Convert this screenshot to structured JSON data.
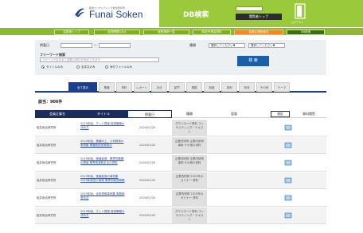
{
  "header": {
    "logo_small": "経営コンサルティング総合研究所",
    "logo_text": "Funai Soken",
    "db_title": "DB検索",
    "top_button": "閲覧者トップ",
    "user_icon_label": "ログアウト"
  },
  "nav": {
    "items": [
      {
        "label": "会員様トップ"
      },
      {
        "label": "経営問題Q＆A"
      },
      {
        "label": "経営事例一覧"
      },
      {
        "label": "時流予測会資料"
      },
      {
        "label": "会員企業様案内"
      },
      {
        "label": "DB検索"
      }
    ]
  },
  "search": {
    "period_label": "掲載日",
    "period_sep": "〜",
    "category_label": "種類",
    "category_value1": "選択してください▼",
    "category_value2": "選択してください▼",
    "freeword_label": "フリーワード検索",
    "freeword_placeholder": "スペースで区切ると複数の条件を指定できます",
    "radio_title": "タイトルのみ",
    "radio_all": "全本文のみ",
    "radio_file": "添付ファイルのみ",
    "search_button": "検 索"
  },
  "tabs": [
    {
      "label": "全て表示"
    },
    {
      "label": "業種"
    },
    {
      "label": "資料"
    },
    {
      "label": "レポート"
    },
    {
      "label": "手法"
    },
    {
      "label": "部門"
    },
    {
      "label": "規模"
    },
    {
      "label": "制度"
    },
    {
      "label": "事例"
    },
    {
      "label": "時流"
    },
    {
      "label": "その他"
    },
    {
      "label": "テーマ"
    }
  ],
  "results": {
    "count_label": "該当：906件"
  },
  "table": {
    "headers": {
      "org": "会員企業名",
      "title": "タイトル",
      "date": "掲載日",
      "kind": "種類",
      "size": "容量",
      "sort": "閲覧",
      "dl": "資料閲覧"
    },
    "rows": [
      {
        "org": "船井総合研究所",
        "title": "2019年版、グッド提案 経営戦略の決め方",
        "date": "2020/01/20",
        "kind": "ダウンロード資料 コンサルティング・テキスト"
      },
      {
        "org": "船井総合研究所",
        "title": "2019年版、業績向上、人材教育の実例集 業種別経営実践法",
        "date": "2020/01/20",
        "kind": "企業内研修 企業内研修事例 その他の資料"
      },
      {
        "org": "船井総合研究所",
        "title": "2019年版、価値創造、業界別戦略の提案 業界別実践手法の資料",
        "date": "2020/01/20",
        "kind": "企業内研修 企業内研修事例 その他の資料"
      },
      {
        "org": "船井総合研究所",
        "title": "2019年版、価値創造の事例集 2019年経営の実践 業界別経営戦略",
        "date": "2020/01/20",
        "kind": "企業内研修 2019年のセミナー 資料"
      },
      {
        "org": "船井総合研究所",
        "title": "2019年版、全体提案事例集 実務経営手法",
        "date": "2020/01/20",
        "kind": "企業内研修 2019年のセミナー 資料"
      },
      {
        "org": "船井総合研究所",
        "title": "2019年版、グッド提案 経営戦略の決め方",
        "date": "2020/01/20",
        "kind": "ダウンロード資料 コンサルティング・テキスト"
      }
    ]
  },
  "colors": {
    "brand_green": "#9ac93b",
    "nav_orange": "#f08a24",
    "navy": "#1b2b5c",
    "link_blue": "#2a52b4"
  }
}
